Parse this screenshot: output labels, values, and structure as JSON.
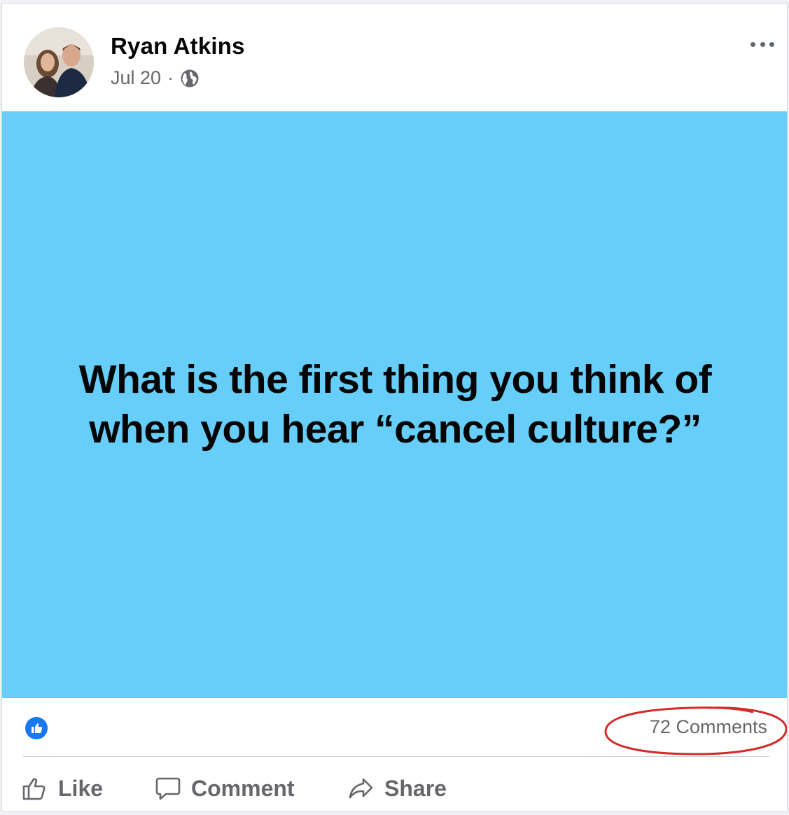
{
  "post": {
    "author": "Ryan Atkins",
    "date": "Jul 20",
    "separator": "·",
    "privacy_icon": "globe-icon",
    "menu_icon": "more-options-icon",
    "background_color": "#66cef9",
    "text": "What is the first thing you think of when you hear “cancel culture?”"
  },
  "footer": {
    "reaction_icon": "like-reaction-icon",
    "reaction_color": "#1877f2",
    "comments_label": "72 Comments",
    "annotation_color": "#d42a2a"
  },
  "actions": {
    "like": "Like",
    "comment": "Comment",
    "share": "Share"
  }
}
